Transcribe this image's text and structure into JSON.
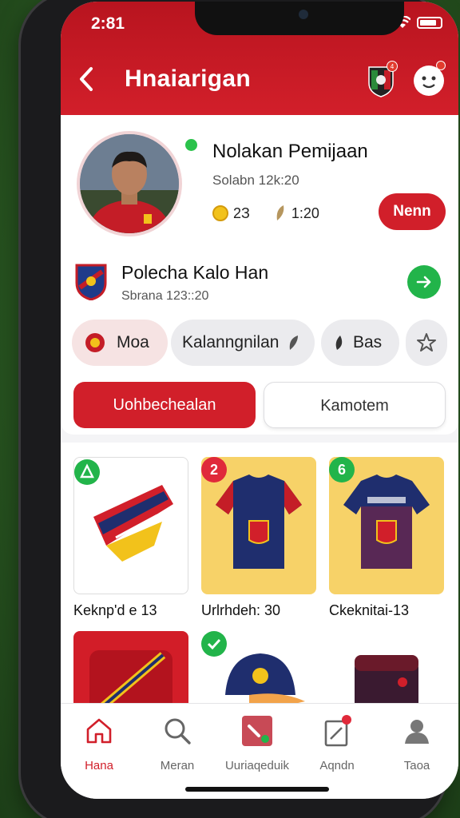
{
  "status": {
    "time": "2:81"
  },
  "header": {
    "title": "Hnaiarigan",
    "badge_count": "4"
  },
  "profile": {
    "name": "Nolakan Pemijaan",
    "subtitle": "Solabn 12k:20",
    "stat_coins": "2З",
    "stat_other": "1:20",
    "new_button": "Nenn"
  },
  "team": {
    "name": "Polecha Kalo Han",
    "subtitle": "Sbrana 123::20"
  },
  "chips": [
    {
      "label": "Mоа",
      "active": true
    },
    {
      "label": "Kalanngnilan",
      "active": false
    },
    {
      "label": "Bas",
      "active": false
    }
  ],
  "segments": {
    "primary": "Uohbechealan",
    "secondary": "Kamotem"
  },
  "products": [
    {
      "label": "Keknp'd e 13",
      "badge": "",
      "badge_color": "#22b44a"
    },
    {
      "label": "Urlrhdeh: 30",
      "badge": "2",
      "badge_color": "#e0293a"
    },
    {
      "label": "Ckeknitai-13",
      "badge": "6",
      "badge_color": "#22b44a"
    }
  ],
  "tabs": [
    {
      "label": "Hana",
      "icon": "home-icon",
      "active": true
    },
    {
      "label": "Meran",
      "icon": "search-icon",
      "active": false
    },
    {
      "label": "Uuriaqeduik",
      "icon": "shop-icon",
      "active": false
    },
    {
      "label": "Aqndn",
      "icon": "clipboard-icon",
      "active": false
    },
    {
      "label": "Taoa",
      "icon": "profile-icon",
      "active": false
    }
  ],
  "colors": {
    "brand_red": "#d11f2a",
    "accent_green": "#22b44a",
    "accent_yellow": "#f7d268"
  }
}
